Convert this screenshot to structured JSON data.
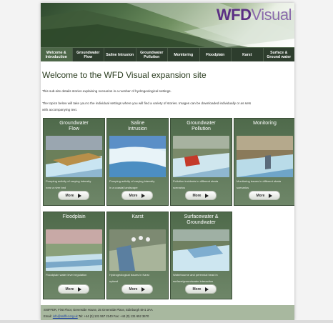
{
  "logo": {
    "part1": "WFD",
    "part2": "Visual"
  },
  "nav": [
    {
      "label": "Welcome & Introduction",
      "active": true
    },
    {
      "label": "Groundwater Flow",
      "active": false
    },
    {
      "label": "Saline Intrusion",
      "active": false
    },
    {
      "label": "Groundwater Pollution",
      "active": false
    },
    {
      "label": "Monitoring",
      "active": false
    },
    {
      "label": "Floodplain",
      "active": false
    },
    {
      "label": "Karst",
      "active": false
    },
    {
      "label": "Surface & Ground water",
      "active": false
    }
  ],
  "main": {
    "title": "Welcome to the WFD Visual expansion site",
    "intro1": "This sub-site details stories explaining scenarios in a number of hydrogeological settings.",
    "intro2a": "The topics below will take you to the individual settings where you will find a variety of stories. Images can be downloaded individually or as sets",
    "intro2b": "with accompanying text."
  },
  "cards": [
    {
      "title1": "Groundwater",
      "title2": "Flow",
      "desc1": "Pumping activity of varying intensity",
      "desc2": "near a river bed",
      "more": "More",
      "scene": "flow"
    },
    {
      "title1": "Saline",
      "title2": "Intrusion",
      "desc1": "Pumping activity of varying intensity",
      "desc2": "in a coastal landscape",
      "more": "More",
      "scene": "saline"
    },
    {
      "title1": "Groundwater",
      "title2": "Pollution",
      "desc1": "Pollution incidents in different strata",
      "desc2": "scenarios",
      "more": "More",
      "scene": "pollution"
    },
    {
      "title1": "Monitoring",
      "title2": "",
      "desc1": "Monitoring issues in different strata",
      "desc2": "scenarios",
      "more": "More",
      "scene": "monitoring"
    },
    {
      "title1": "Floodplain",
      "title2": "",
      "desc1": "Floodplain water level regulation",
      "desc2": "",
      "more": "More",
      "scene": "floodplain"
    },
    {
      "title1": "Karst",
      "title2": "",
      "desc1": "Hydrogeological issues in Karst",
      "desc2": "upland",
      "more": "More",
      "scene": "karst"
    },
    {
      "title1": "Surfacewater &",
      "title2": "Groundwater",
      "desc1": "Waterbourne and perennial head in",
      "desc2": "surface/groundwater interaction",
      "more": "More",
      "scene": "surface"
    }
  ],
  "footer": {
    "line1": "SNIFFER, First Floor, Greenside House, 25 Greenside Place, Edinburgh EH1 3AA",
    "email_label": "Email:",
    "email": "info@sniffer.org.uk",
    "contact": "Tel: +44 (0) 131 557 2140 Fax: +44 (0) 131 652 3670"
  }
}
